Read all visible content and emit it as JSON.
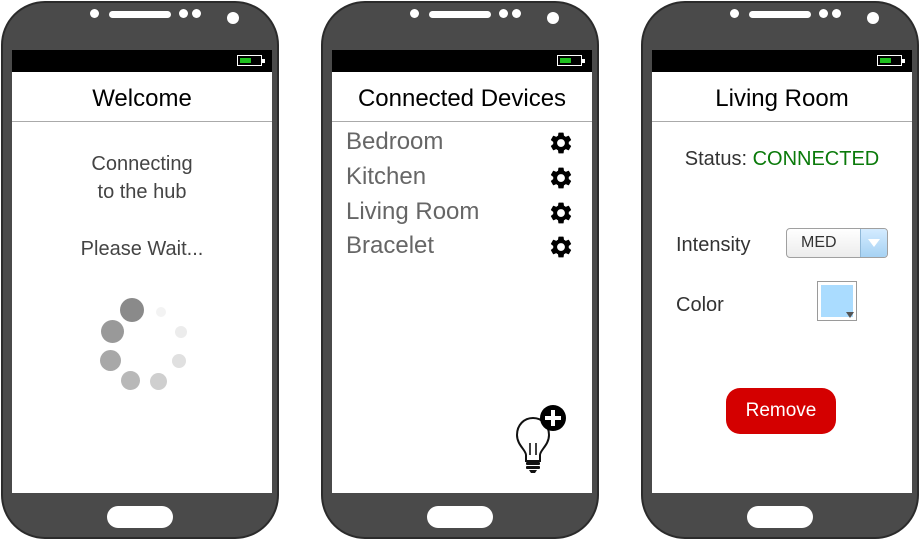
{
  "screens": [
    {
      "title": "Welcome",
      "message_line1": "Connecting",
      "message_line2": "to the hub",
      "wait_text": "Please Wait..."
    },
    {
      "title": "Connected Devices",
      "devices": [
        {
          "label": "Bedroom"
        },
        {
          "label": "Kitchen"
        },
        {
          "label": "Living Room"
        },
        {
          "label": "Bracelet"
        }
      ],
      "device_settings_icon": "gear-icon",
      "add_device_icon": "lightbulb-plus-icon"
    },
    {
      "title": "Living Room",
      "status_label": "Status:",
      "status_value": "CONNECTED",
      "intensity_label": "Intensity",
      "intensity_value": "MED",
      "color_label": "Color",
      "remove_label": "Remove"
    }
  ],
  "colors": {
    "phone_body": "#4a4a4a",
    "battery": "#1ec01e",
    "status_connected": "#0a7a0a",
    "remove_button": "#d40000",
    "selected_color": "#aadcff"
  }
}
